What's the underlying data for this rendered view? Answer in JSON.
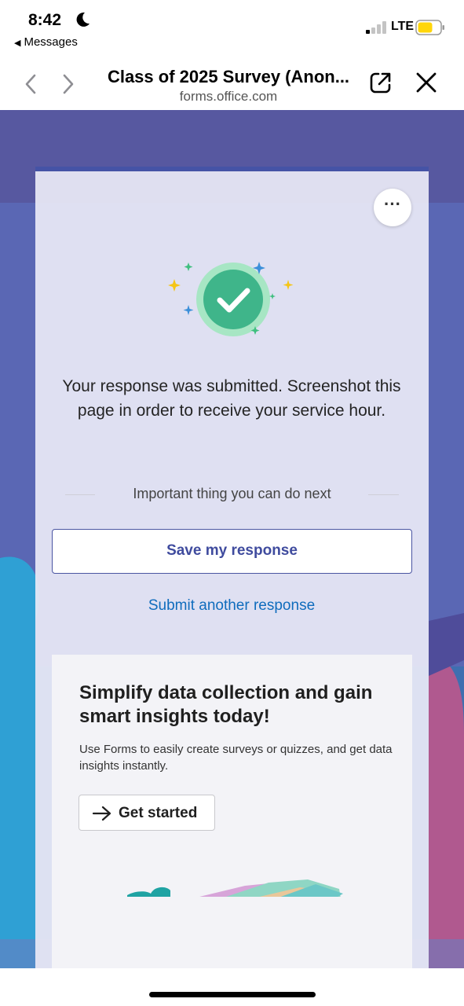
{
  "status_bar": {
    "time": "8:42",
    "back_app": "Messages",
    "network": "LTE",
    "battery_color": "#ffd60a"
  },
  "browser": {
    "title": "Class of 2025 Survey (Anon...",
    "url": "forms.office.com",
    "icons": [
      "back-chevron-icon",
      "forward-chevron-icon",
      "open-external-icon",
      "close-icon"
    ]
  },
  "card": {
    "more_label": "···",
    "confirmation": "Your response was submitted. Screenshot this page in order to receive your service hour.",
    "next_heading": "Important thing you can do next",
    "save_button": "Save my response",
    "submit_another": "Submit another response",
    "accent_color": "#4553a6"
  },
  "promo": {
    "title": "Simplify data collection and gain smart insights today!",
    "description": "Use Forms to easily create surveys or quizzes, and get data insights instantly.",
    "cta": "Get started"
  }
}
